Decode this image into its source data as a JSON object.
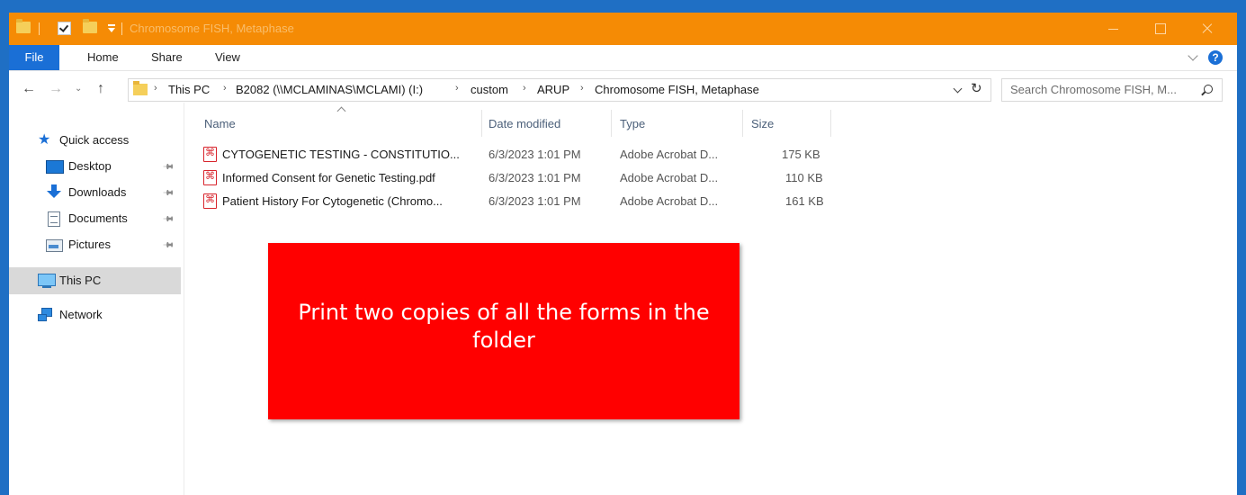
{
  "window": {
    "title": "Chromosome FISH, Metaphase",
    "colors": {
      "titlebar": "#f58b05",
      "accent": "#1a6fd6",
      "overlay": "#ff0000"
    }
  },
  "ribbon": {
    "tabs": [
      "File",
      "Home",
      "Share",
      "View"
    ],
    "help_label": "?"
  },
  "address": {
    "breadcrumbs": [
      "This PC",
      "B2082 (\\\\MCLAMINAS\\MCLAMI) (I:)",
      "custom",
      "ARUP",
      "Chromosome FISH, Metaphase"
    ]
  },
  "search": {
    "placeholder": "Search Chromosome FISH, M..."
  },
  "sidebar": {
    "items": [
      {
        "label": "Quick access",
        "icon": "star-icon"
      },
      {
        "label": "Desktop",
        "icon": "desktop-icon",
        "pinned": true
      },
      {
        "label": "Downloads",
        "icon": "download-arrow-icon",
        "pinned": true
      },
      {
        "label": "Documents",
        "icon": "document-icon",
        "pinned": true
      },
      {
        "label": "Pictures",
        "icon": "pictures-icon",
        "pinned": true
      },
      {
        "label": "This PC",
        "icon": "computer-icon",
        "selected": true
      },
      {
        "label": "Network",
        "icon": "network-icon"
      }
    ]
  },
  "files": {
    "columns": [
      "Name",
      "Date modified",
      "Type",
      "Size"
    ],
    "rows": [
      {
        "name": "CYTOGENETIC TESTING - CONSTITUTIO...",
        "date": "6/3/2023 1:01 PM",
        "type": "Adobe Acrobat D...",
        "size": "175 KB"
      },
      {
        "name": "Informed Consent for Genetic Testing.pdf",
        "date": "6/3/2023 1:01 PM",
        "type": "Adobe Acrobat D...",
        "size": "110 KB"
      },
      {
        "name": "Patient History For Cytogenetic (Chromo...",
        "date": "6/3/2023 1:01 PM",
        "type": "Adobe Acrobat D...",
        "size": "161 KB"
      }
    ]
  },
  "overlay": {
    "text": "Print two copies of all the forms in the folder"
  }
}
